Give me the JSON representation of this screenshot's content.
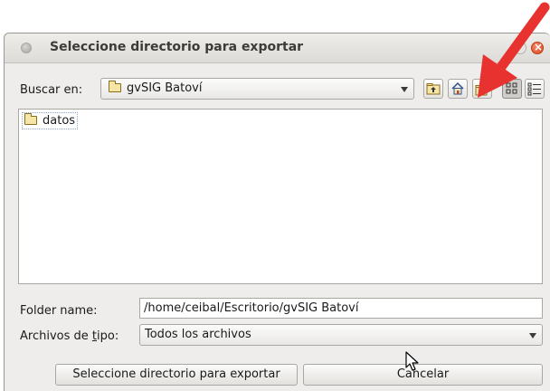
{
  "dialog": {
    "title": "Seleccione directorio para exportar"
  },
  "look_in": {
    "label": "Buscar en:",
    "value": "gvSIG Batoví"
  },
  "toolbar": {
    "icons": [
      "up-folder-icon",
      "home-icon",
      "new-folder-icon",
      "list-view-icon",
      "details-view-icon"
    ]
  },
  "file_list": {
    "items": [
      {
        "name": "datos",
        "icon": "folder-icon"
      }
    ]
  },
  "folder_name": {
    "label": "Folder name:",
    "value": "/home/ceibal/Escritorio/gvSIG Batoví"
  },
  "file_type": {
    "label_pre": "Archivos de ",
    "label_mnemonic": "t",
    "label_post": "ipo:",
    "value": "Todos los archivos"
  },
  "buttons": {
    "approve_label": "Seleccione directorio para exportar",
    "cancel_label": "Cancelar"
  },
  "colors": {
    "annotation_arrow": "#e8322f",
    "close_button": "#df4a21",
    "dialog_bg": "#efedeb"
  }
}
